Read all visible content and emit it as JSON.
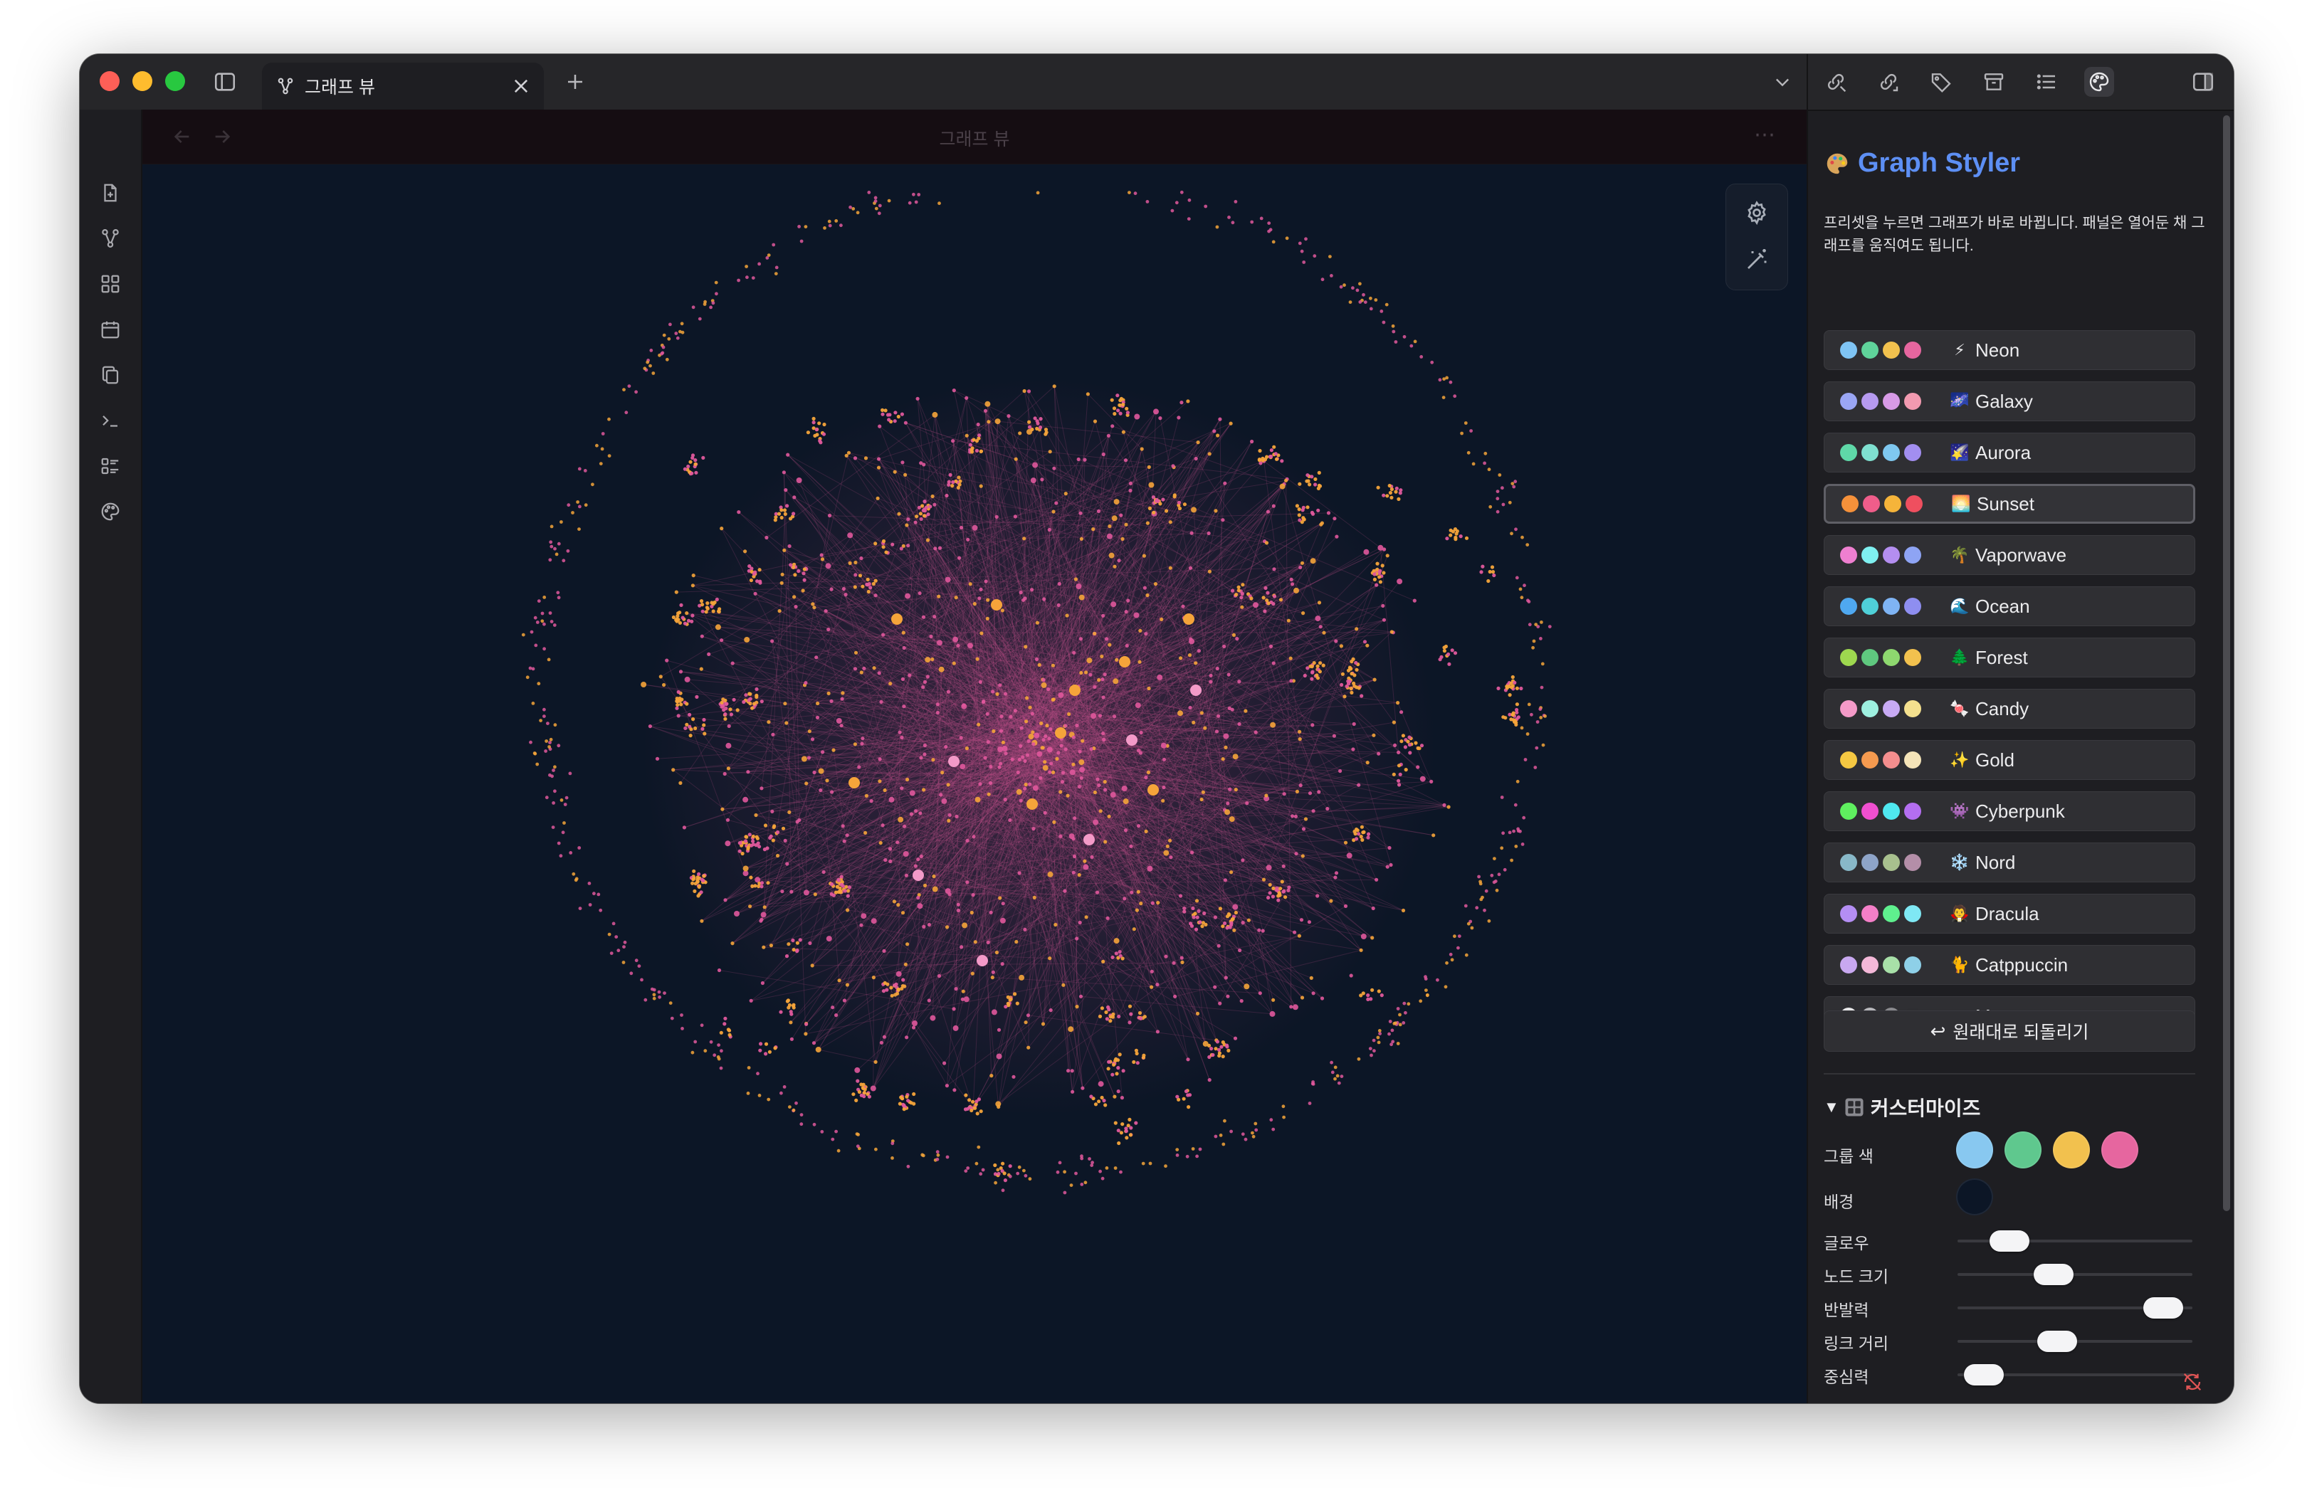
{
  "tab": {
    "label": "그래프 뷰"
  },
  "view": {
    "title": "그래프 뷰"
  },
  "colors": {
    "graph_background": "#0c1626",
    "accent": "#5d8ff4",
    "node_pink": "#e0589c",
    "node_orange": "#f5a43a"
  },
  "panel": {
    "icon": "palette-icon",
    "title": "Graph Styler",
    "description": "프리셋을 누르면 그래프가 바로 바뀝니다. 패널은 열어둔 채 그래프를 움직여도 됩니다.",
    "presets": [
      {
        "label": "Neon",
        "emoji": "⚡",
        "colors": [
          "#7fc4f4",
          "#5fd39a",
          "#f2c14e",
          "#e6669f"
        ]
      },
      {
        "label": "Galaxy",
        "emoji": "🌌",
        "colors": [
          "#9aa6f4",
          "#b69af0",
          "#d79ae6",
          "#f29ab0"
        ]
      },
      {
        "label": "Aurora",
        "emoji": "🌠",
        "colors": [
          "#5fd8a8",
          "#7fe0d0",
          "#7fc8f0",
          "#a28ef0"
        ]
      },
      {
        "label": "Sunset",
        "emoji": "🌅",
        "colors": [
          "#f5913a",
          "#ef5d8a",
          "#f5b43a",
          "#ef4f5f"
        ]
      },
      {
        "label": "Vaporwave",
        "emoji": "🌴",
        "colors": [
          "#ef7fd0",
          "#7ff0f0",
          "#b48ef0",
          "#8ea4f4"
        ]
      },
      {
        "label": "Ocean",
        "emoji": "🌊",
        "colors": [
          "#4fa8f0",
          "#4fd0d8",
          "#7fb4f4",
          "#8e8ef0"
        ]
      },
      {
        "label": "Forest",
        "emoji": "🌲",
        "colors": [
          "#9ed84f",
          "#5fc87f",
          "#8ed86f",
          "#f2c14e"
        ]
      },
      {
        "label": "Candy",
        "emoji": "🍬",
        "colors": [
          "#f49ac8",
          "#9ef0e0",
          "#c8aaf4",
          "#f4e08e"
        ]
      },
      {
        "label": "Gold",
        "emoji": "✨",
        "colors": [
          "#f5c842",
          "#f59a4f",
          "#f48e8e",
          "#f4e4b8"
        ]
      },
      {
        "label": "Cyberpunk",
        "emoji": "👾",
        "colors": [
          "#5ff05f",
          "#f04fd0",
          "#4fe8f0",
          "#b46ef0"
        ]
      },
      {
        "label": "Nord",
        "emoji": "❄️",
        "colors": [
          "#88b8c8",
          "#8ea4c8",
          "#a8c08e",
          "#b48ea8"
        ]
      },
      {
        "label": "Dracula",
        "emoji": "🧛",
        "colors": [
          "#b48ef4",
          "#f47fc8",
          "#5ff08e",
          "#7fe8f4"
        ]
      },
      {
        "label": "Catppuccin",
        "emoji": "🐈",
        "colors": [
          "#c8a8f0",
          "#f4b8d8",
          "#a8e0a8",
          "#8ed0e8"
        ]
      },
      {
        "label": "Mono",
        "emoji": "⚪",
        "colors": [
          "#e8e8ea",
          "#b8b8bc",
          "#8a8a8e",
          "#2e2e32"
        ]
      }
    ],
    "reset_label": "원래대로 되돌리기",
    "customize": {
      "title": "커스터마이즈",
      "group_color_label": "그룹 색",
      "group_colors": [
        "#88c8f0",
        "#5fc88e",
        "#f2c14e",
        "#e6669f"
      ],
      "background_label": "배경",
      "background_color": "#0c1626",
      "sliders": [
        {
          "label": "글로우",
          "value": 0.15
        },
        {
          "label": "노드 크기",
          "value": 0.38
        },
        {
          "label": "반발력",
          "value": 0.95
        },
        {
          "label": "링크 거리",
          "value": 0.4
        },
        {
          "label": "중심력",
          "value": 0.02
        }
      ]
    }
  }
}
